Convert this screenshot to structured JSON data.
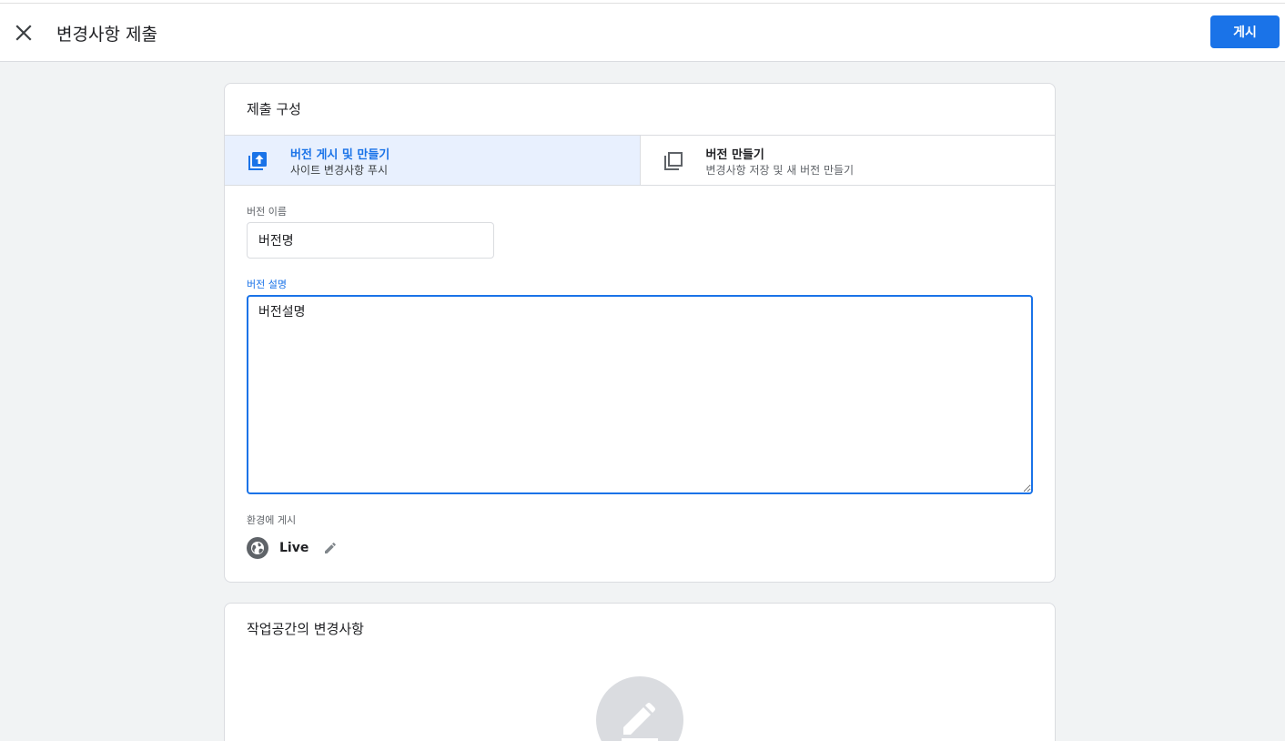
{
  "header": {
    "title": "변경사항 제출",
    "publish_label": "게시"
  },
  "config": {
    "title": "제출 구성",
    "options": [
      {
        "title": "버전 게시 및 만들기",
        "subtitle": "사이트 변경사항 푸시",
        "icon": "publish-icon",
        "selected": true
      },
      {
        "title": "버전 만들기",
        "subtitle": "변경사항 저장 및 새 버전 만들기",
        "icon": "copy-icon",
        "selected": false
      }
    ],
    "version_name": {
      "label": "버전 이름",
      "value": "버전명"
    },
    "version_description": {
      "label": "버전 설명",
      "value": "버전설명"
    },
    "environment": {
      "label": "환경에 게시",
      "name": "Live",
      "icon": "globe-icon",
      "edit_icon": "pencil-icon"
    }
  },
  "changes": {
    "title": "작업공간의 변경사항",
    "icon": "edit-icon"
  },
  "colors": {
    "accent": "#1a73e8",
    "selected_bg": "#e8f0fe",
    "page_bg": "#f1f3f4"
  }
}
